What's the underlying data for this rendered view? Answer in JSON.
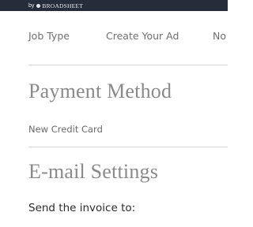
{
  "header": {
    "by_label": "by",
    "brand_name": "BROADSHEET",
    "brand_icon": "dot-icon"
  },
  "tabs": [
    {
      "label": "Job Type"
    },
    {
      "label": "Create Your Ad"
    },
    {
      "label": "No"
    }
  ],
  "payment": {
    "title": "Payment Method",
    "option_label": "New Credit Card"
  },
  "email": {
    "title": "E-mail Settings",
    "invoice_label": "Send the invoice to:"
  },
  "colors": {
    "topbar": "#252c3a",
    "section_title": "#8a8a8a",
    "tab_text": "#6f6f6f",
    "divider": "#d4d4d4"
  }
}
